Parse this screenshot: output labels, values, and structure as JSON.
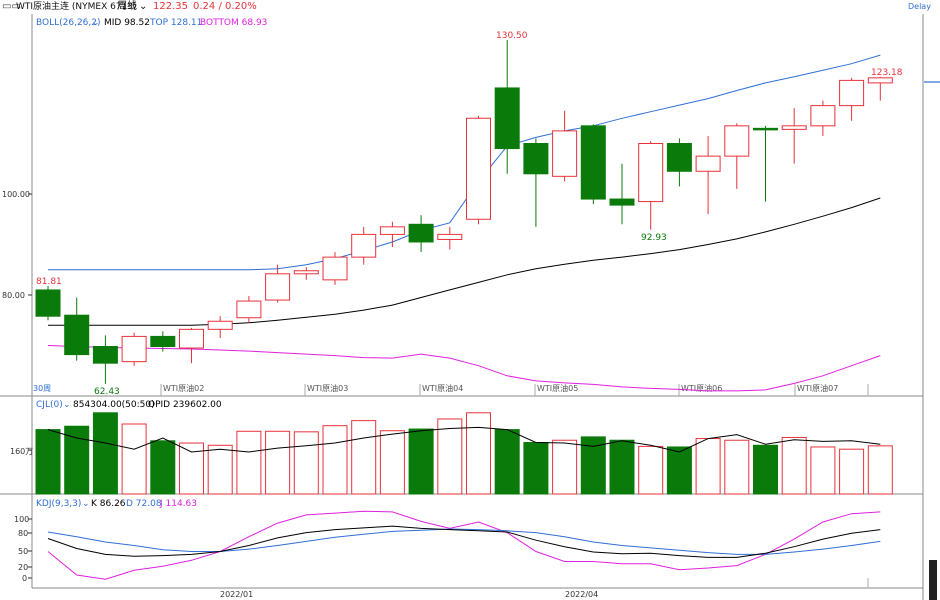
{
  "header": {
    "instrument": "WTI原油主连 (NYMEX 6713)",
    "period": "周线",
    "price": "122.35",
    "change": "0.24 / 0.20%",
    "delay": "Delay"
  },
  "boll_panel": {
    "label": "BOLL(26,26,2)",
    "mid": "MID 98.52",
    "top": "TOP 128.11",
    "bottom": "BOTTOM 68.93",
    "y_ticks": [
      "100.00",
      "80.00"
    ],
    "annotations": [
      "130.50",
      "123.18",
      "81.81",
      "62.43",
      "92.93"
    ],
    "period_badge": "30周",
    "contract_labels": [
      "WTI原油02",
      "WTI原油03",
      "WTI原油04",
      "WTI原油05",
      "WTI原油06",
      "WTI原油07"
    ]
  },
  "volume_panel": {
    "label": "CJL(0)",
    "values": "854304.00(50:50)",
    "opid": "OPID 239602.00",
    "y_tick": "160万"
  },
  "kdj_panel": {
    "label": "KDJ(9,3,3)",
    "k": "K 86.26",
    "d": "D 72.08",
    "j": "J 114.63",
    "y_ticks": [
      "100",
      "80",
      "50",
      "20",
      "0"
    ]
  },
  "x_axis": {
    "labels": [
      "2022/01",
      "2022/04"
    ]
  },
  "colors": {
    "up": "#e8313a",
    "down": "#0a7a0a",
    "boll_top": "#2f6fd6",
    "boll_mid": "#000000",
    "boll_bottom": "#e020e0",
    "k_line": "#000000",
    "d_line": "#2f6fd6",
    "j_line": "#e020e0"
  },
  "chart_data": {
    "type": "candlestick",
    "candles": [
      {
        "o": 81.0,
        "h": 81.8,
        "c": 75.8,
        "l": 75.0
      },
      {
        "o": 76.0,
        "h": 79.5,
        "c": 68.2,
        "l": 67.0
      },
      {
        "o": 69.8,
        "h": 72.0,
        "c": 66.5,
        "l": 62.4
      },
      {
        "o": 66.8,
        "h": 72.5,
        "c": 71.8,
        "l": 66.0
      },
      {
        "o": 71.8,
        "h": 72.8,
        "c": 69.8,
        "l": 68.8
      },
      {
        "o": 69.5,
        "h": 73.5,
        "c": 73.2,
        "l": 66.5
      },
      {
        "o": 73.2,
        "h": 75.8,
        "c": 74.8,
        "l": 71.5
      },
      {
        "o": 75.5,
        "h": 79.8,
        "c": 78.8,
        "l": 74.5
      },
      {
        "o": 79.0,
        "h": 86.0,
        "c": 84.2,
        "l": 78.5
      },
      {
        "o": 84.2,
        "h": 85.5,
        "c": 84.8,
        "l": 83.0
      },
      {
        "o": 83.0,
        "h": 88.5,
        "c": 87.5,
        "l": 82.0
      },
      {
        "o": 87.5,
        "h": 93.5,
        "c": 92.0,
        "l": 86.0
      },
      {
        "o": 92.0,
        "h": 94.5,
        "c": 93.5,
        "l": 89.5
      },
      {
        "o": 94.0,
        "h": 95.8,
        "c": 90.5,
        "l": 88.5
      },
      {
        "o": 91.0,
        "h": 93.5,
        "c": 92.0,
        "l": 89.0
      },
      {
        "o": 95.0,
        "h": 115.5,
        "c": 115.0,
        "l": 94.0
      },
      {
        "o": 121.0,
        "h": 130.5,
        "c": 109.0,
        "l": 104.0
      },
      {
        "o": 110.0,
        "h": 111.0,
        "c": 104.0,
        "l": 93.5
      },
      {
        "o": 103.5,
        "h": 116.5,
        "c": 112.5,
        "l": 102.5
      },
      {
        "o": 113.5,
        "h": 113.8,
        "c": 99.0,
        "l": 98.0
      },
      {
        "o": 99.0,
        "h": 106.0,
        "c": 97.8,
        "l": 94.0
      },
      {
        "o": 98.5,
        "h": 110.5,
        "c": 110.0,
        "l": 92.9
      },
      {
        "o": 110.0,
        "h": 111.0,
        "c": 104.5,
        "l": 101.5
      },
      {
        "o": 104.5,
        "h": 111.5,
        "c": 107.5,
        "l": 96.0
      },
      {
        "o": 107.5,
        "h": 114.0,
        "c": 113.5,
        "l": 101.0
      },
      {
        "o": 113.0,
        "h": 113.5,
        "c": 112.8,
        "l": 98.5
      },
      {
        "o": 112.8,
        "h": 117.0,
        "c": 113.5,
        "l": 106.0
      },
      {
        "o": 113.5,
        "h": 118.5,
        "c": 117.5,
        "l": 111.5
      },
      {
        "o": 117.5,
        "h": 123.0,
        "c": 122.5,
        "l": 114.5
      },
      {
        "o": 122.0,
        "h": 123.2,
        "c": 123.0,
        "l": 118.5
      }
    ],
    "boll_top": [
      85.0,
      85.0,
      85.0,
      85.0,
      85.0,
      85.0,
      85.0,
      85.0,
      85.2,
      86.0,
      87.2,
      88.8,
      90.5,
      92.8,
      94.3,
      102.5,
      109.5,
      111.2,
      112.5,
      113.5,
      115.0,
      116.3,
      117.6,
      118.9,
      120.5,
      122.0,
      123.2,
      124.5,
      125.8,
      127.5
    ],
    "boll_mid": [
      74.0,
      74.0,
      74.0,
      74.0,
      74.0,
      74.0,
      74.2,
      74.5,
      75.0,
      75.6,
      76.2,
      77.0,
      78.0,
      79.5,
      81.0,
      82.5,
      84.0,
      85.2,
      86.1,
      86.9,
      87.5,
      88.2,
      89.0,
      90.0,
      91.1,
      92.5,
      94.0,
      95.6,
      97.3,
      99.2
    ],
    "boll_bottom": [
      70.0,
      69.8,
      69.6,
      69.5,
      69.4,
      69.3,
      69.1,
      68.9,
      68.6,
      68.3,
      68.0,
      67.6,
      67.5,
      68.3,
      67.5,
      66.0,
      64.0,
      63.0,
      62.6,
      62.3,
      61.8,
      61.5,
      61.3,
      61.0,
      61.0,
      61.2,
      62.5,
      64.0,
      66.0,
      68.0
    ],
    "volume": [
      115,
      121,
      145,
      125,
      95,
      91,
      87,
      112,
      112,
      111,
      122,
      131,
      113,
      116,
      134,
      145,
      115,
      92,
      96,
      102,
      96,
      85,
      84,
      99,
      96,
      87,
      101,
      84,
      80,
      86,
      69
    ],
    "volume_line": [
      115,
      100,
      91,
      80,
      100,
      75,
      80,
      75,
      82,
      86,
      91,
      100,
      107,
      113,
      117,
      119,
      115,
      92,
      91,
      85,
      95,
      87,
      75,
      99,
      106,
      89,
      97,
      94,
      95,
      89,
      83
    ],
    "kdj_k": [
      67,
      50,
      40,
      37,
      38,
      40,
      45,
      55,
      68,
      77,
      82,
      85,
      88,
      84,
      82,
      80,
      78,
      64,
      53,
      44,
      41,
      42,
      38,
      35,
      35,
      42,
      53,
      66,
      76,
      82,
      86
    ],
    "kdj_d": [
      78,
      70,
      61,
      55,
      48,
      45,
      45,
      49,
      55,
      62,
      69,
      74,
      79,
      81,
      83,
      82,
      80,
      77,
      70,
      61,
      55,
      51,
      47,
      43,
      40,
      40,
      44,
      49,
      55,
      62,
      72
    ],
    "kdj_j": [
      45,
      5,
      -2,
      13,
      20,
      30,
      45,
      70,
      93,
      107,
      110,
      113,
      112,
      96,
      84,
      95,
      77,
      45,
      28,
      28,
      24,
      24,
      14,
      17,
      21,
      40,
      66,
      95,
      109,
      112,
      114
    ]
  }
}
